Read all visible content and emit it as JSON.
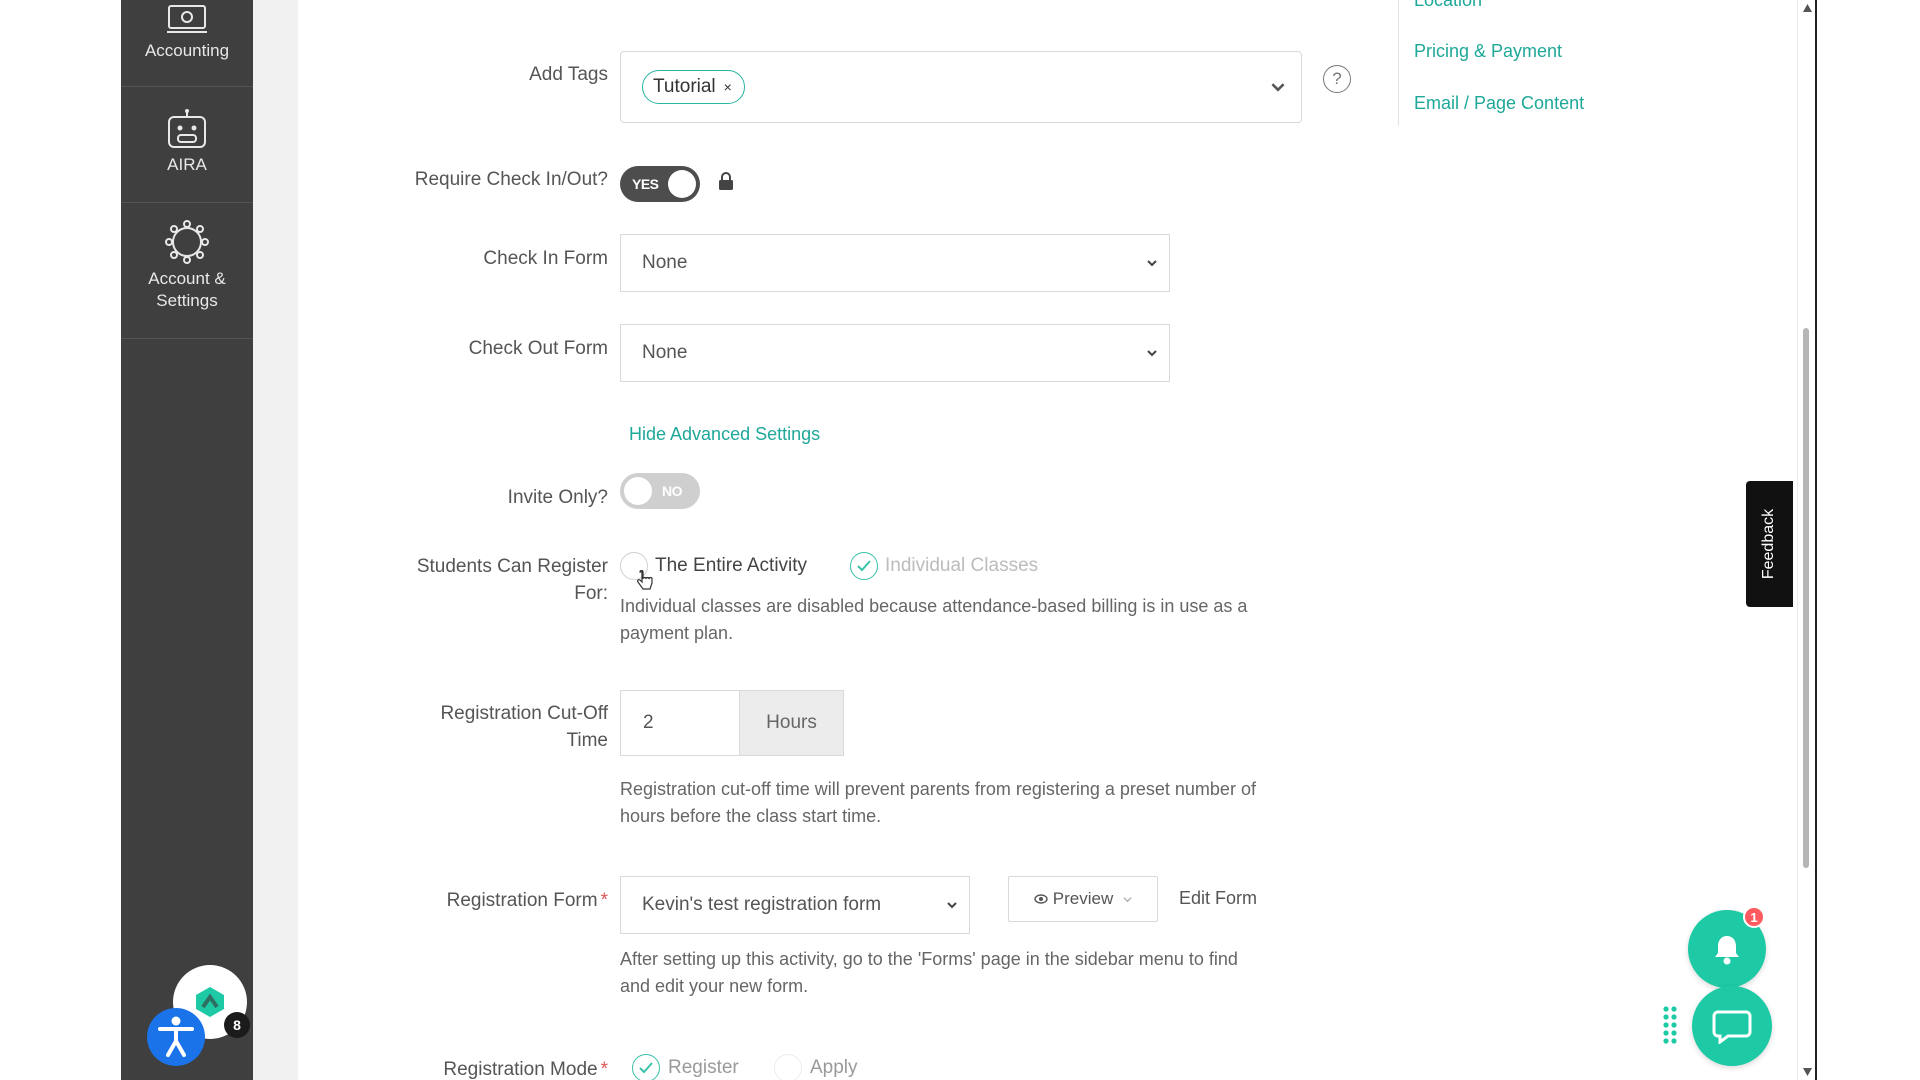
{
  "sidebar": {
    "items": [
      {
        "label": "Accounting",
        "icon": "cash-register-icon"
      },
      {
        "label": "AIRA",
        "icon": "robot-icon"
      },
      {
        "label": "Account & Settings",
        "label_line1": "Account &",
        "label_line2": "Settings",
        "icon": "gear-icon"
      }
    ],
    "profile_badge": "8"
  },
  "section_nav": {
    "items": [
      "Location",
      "Pricing & Payment",
      "Email / Page Content"
    ]
  },
  "form": {
    "add_tags": {
      "label": "Add Tags",
      "tags": [
        "Tutorial"
      ],
      "remove_glyph": "×"
    },
    "require_check": {
      "label": "Require Check In/Out?",
      "value": "YES"
    },
    "check_in_form": {
      "label": "Check In Form",
      "value": "None"
    },
    "check_out_form": {
      "label": "Check Out Form",
      "value": "None"
    },
    "hide_advanced": "Hide Advanced Settings",
    "invite_only": {
      "label": "Invite Only?",
      "value": "NO"
    },
    "students_register": {
      "label_line1": "Students Can Register",
      "label_line2": "For:",
      "option_entire": "The Entire Activity",
      "option_individual": "Individual Classes",
      "help_line1": "Individual classes are disabled because attendance-based billing is in use as a",
      "help_line2": "payment plan."
    },
    "cutoff": {
      "label_line1": "Registration Cut-Off",
      "label_line2": "Time",
      "value": "2",
      "unit": "Hours",
      "help_line1": "Registration cut-off time will prevent parents from registering a preset number of",
      "help_line2": "hours before the class start time."
    },
    "registration_form": {
      "label": "Registration Form",
      "required_mark": "*",
      "value": "Kevin's test registration form",
      "preview_label": "Preview",
      "edit_label": "Edit Form",
      "help_line1": "After setting up this activity, go to the 'Forms' page in the sidebar menu to find",
      "help_line2": "and edit your new form."
    },
    "registration_mode": {
      "label": "Registration Mode",
      "required_mark": "*",
      "option_register": "Register",
      "option_apply": "Apply"
    }
  },
  "feedback_tab": "Feedback",
  "notifications": {
    "count": "1"
  },
  "colors": {
    "accent": "#1ea899",
    "sidebar_bg": "#3f3f3f",
    "fab": "#1ec9a5",
    "badge": "#ff5a5f"
  }
}
